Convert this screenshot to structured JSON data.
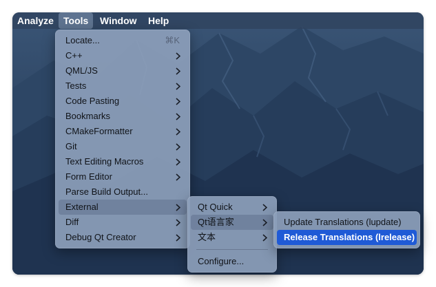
{
  "menubar": {
    "items": [
      {
        "label": "Analyze"
      },
      {
        "label": "Tools"
      },
      {
        "label": "Window"
      },
      {
        "label": "Help"
      }
    ]
  },
  "tools_menu": {
    "locate": {
      "label": "Locate...",
      "shortcut": "⌘K"
    },
    "items": [
      {
        "label": "C++"
      },
      {
        "label": "QML/JS"
      },
      {
        "label": "Tests"
      },
      {
        "label": "Code Pasting"
      },
      {
        "label": "Bookmarks"
      },
      {
        "label": "CMakeFormatter"
      },
      {
        "label": "Git"
      },
      {
        "label": "Text Editing Macros"
      },
      {
        "label": "Form Editor"
      }
    ],
    "parse_build_output": {
      "label": "Parse Build Output..."
    },
    "external": {
      "label": "External"
    },
    "diff": {
      "label": "Diff"
    },
    "debug": {
      "label": "Debug Qt Creator"
    }
  },
  "external_menu": {
    "items": [
      {
        "label": "Qt Quick"
      },
      {
        "label": "Qt语言家"
      },
      {
        "label": "文本"
      }
    ],
    "configure": {
      "label": "Configure..."
    }
  },
  "linguist_menu": {
    "items": [
      {
        "label": "Update Translations (lupdate)"
      },
      {
        "label": "Release Translations (lrelease)"
      }
    ]
  },
  "colors": {
    "selection": "#1f5ad6",
    "menu_background": "#8c9eba",
    "menubar_background": "#30425e"
  }
}
